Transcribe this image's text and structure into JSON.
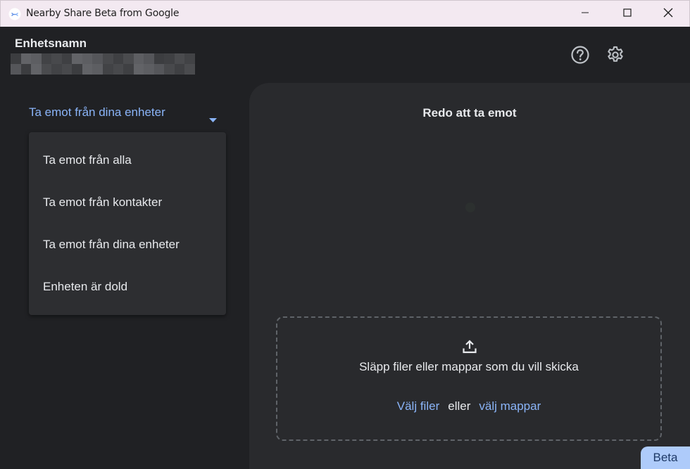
{
  "window": {
    "title": "Nearby Share Beta from Google",
    "icon": "nearby-share-icon",
    "controls": [
      "minimize-icon",
      "maximize-icon",
      "close-icon"
    ]
  },
  "header": {
    "device_label": "Enhetsnamn",
    "device_name_redacted": true,
    "help_icon": "help-icon",
    "settings_icon": "gear-icon"
  },
  "visibility": {
    "selected": "Ta emot från dina enheter",
    "options": [
      "Ta emot från alla",
      "Ta emot från kontakter",
      "Ta emot från dina enheter",
      "Enheten är dold"
    ]
  },
  "receive": {
    "status": "Redo att ta emot"
  },
  "dropzone": {
    "icon": "upload-icon",
    "text": "Släpp filer eller mappar som du vill skicka",
    "choose_files": "Välj filer",
    "or": "eller",
    "choose_folders": "välj mappar"
  },
  "badge": {
    "label": "Beta"
  },
  "colors": {
    "accent": "#8ab4f8",
    "background": "#202124",
    "panel": "#292a2d",
    "menu": "#2d2e31",
    "badge": "#aecbfa"
  }
}
